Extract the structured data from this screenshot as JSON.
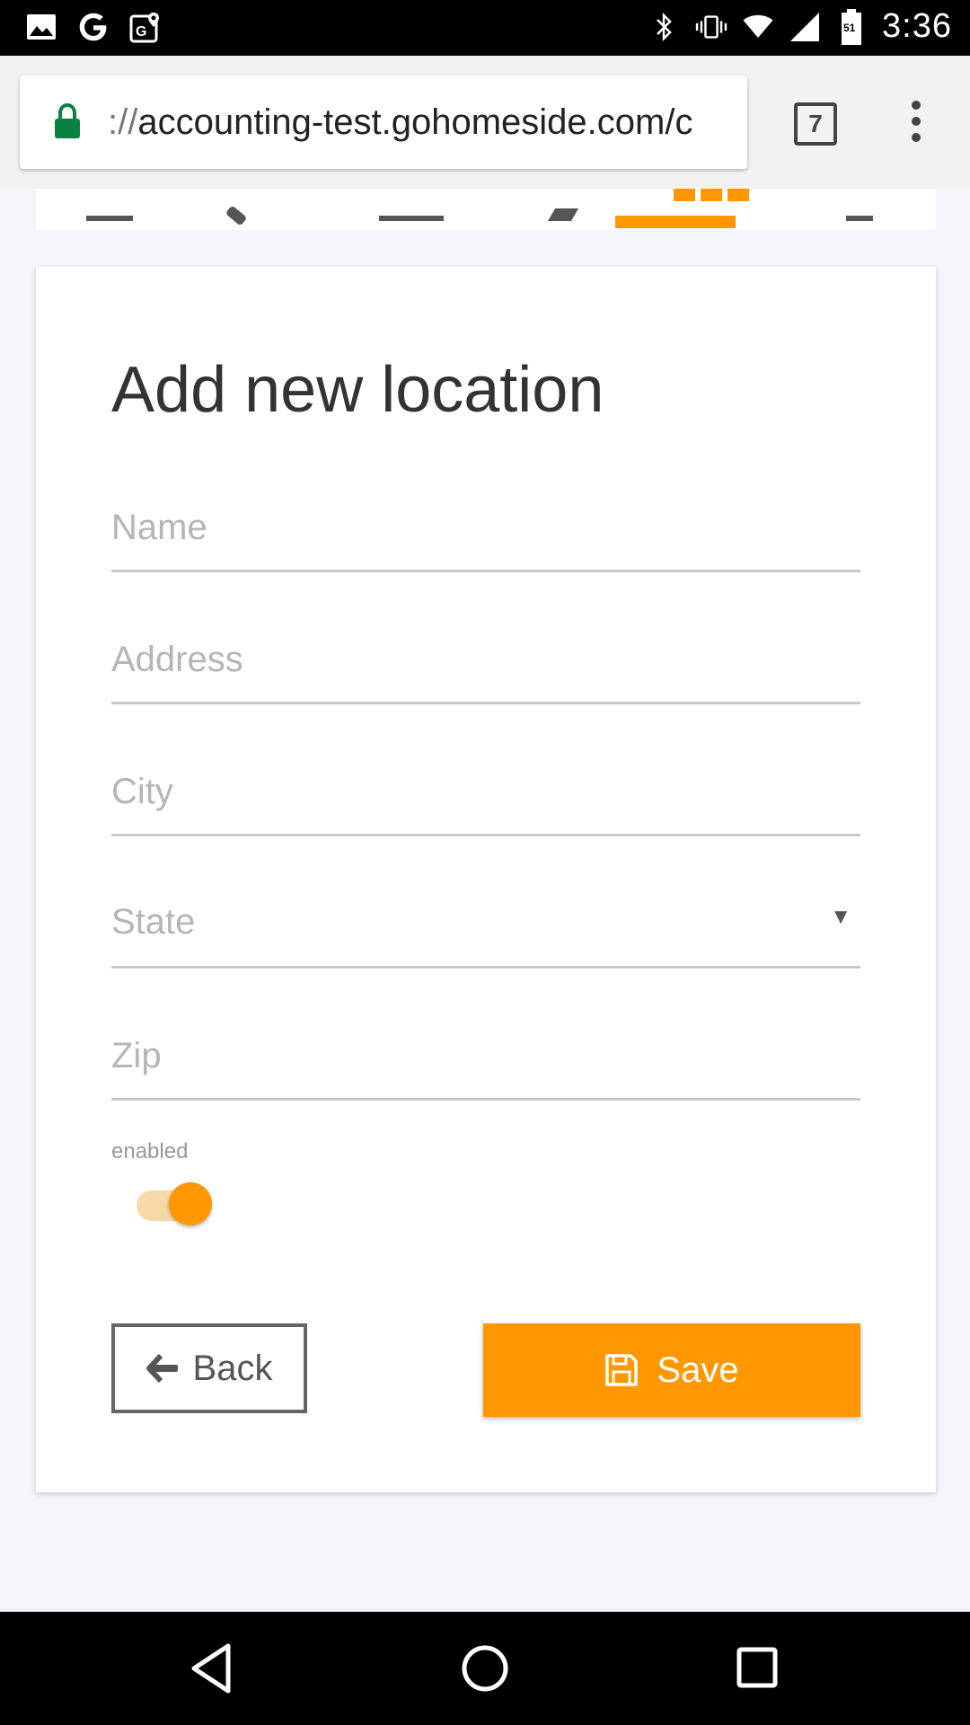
{
  "status_bar": {
    "time": "3:36",
    "battery_level": "51",
    "icons": [
      "image-icon",
      "google-icon",
      "maps-icon",
      "bluetooth-icon",
      "vibrate-icon",
      "wifi-icon",
      "cell-signal-icon",
      "battery-icon"
    ]
  },
  "browser": {
    "url_scheme": "://",
    "url_text": "accounting-test.gohomeside.com/c",
    "tab_count": "7"
  },
  "card": {
    "title": "Add new location",
    "fields": {
      "name_placeholder": "Name",
      "address_placeholder": "Address",
      "city_placeholder": "City",
      "state_placeholder": "State",
      "zip_placeholder": "Zip"
    },
    "toggle": {
      "label": "enabled",
      "on": true
    },
    "buttons": {
      "back_label": "Back",
      "save_label": "Save"
    }
  },
  "colors": {
    "accent": "#ff9800",
    "toggle_track": "#f7d9a9",
    "secure_lock": "#0b8043"
  }
}
